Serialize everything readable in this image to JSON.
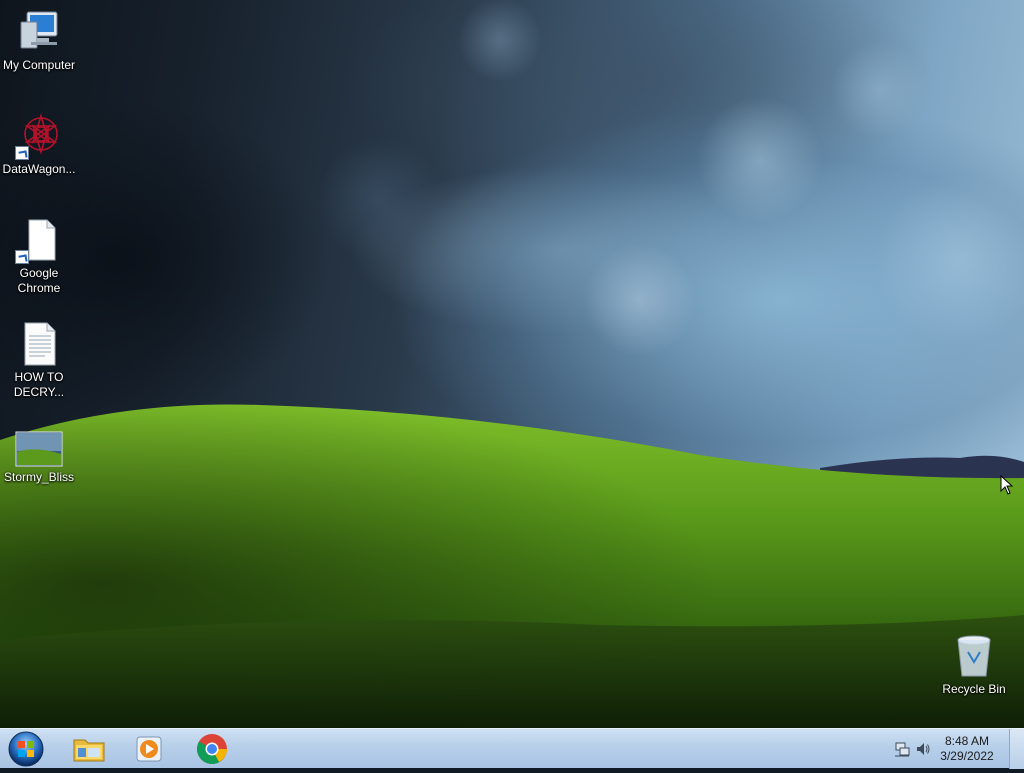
{
  "desktop": {
    "icons": [
      {
        "label": "My Computer",
        "icon": "computer-icon"
      },
      {
        "label": "DataWagon...",
        "icon": "datawagon-shortcut-icon"
      },
      {
        "label": "Google Chrome",
        "icon": "chrome-shortcut-icon"
      },
      {
        "label": "HOW TO DECRY...",
        "icon": "text-document-icon"
      },
      {
        "label": "Stormy_Bliss",
        "icon": "image-file-icon"
      },
      {
        "label": "Recycle Bin",
        "icon": "recycle-bin-icon"
      }
    ]
  },
  "taskbar": {
    "start": {
      "icon": "windows-start-orb-icon"
    },
    "pinned": [
      {
        "name": "Windows Explorer",
        "icon": "folder-icon"
      },
      {
        "name": "Windows Media Player",
        "icon": "media-player-icon"
      },
      {
        "name": "Google Chrome",
        "icon": "chrome-icon"
      }
    ],
    "tray": {
      "network_icon": "network-icon",
      "volume_icon": "speaker-icon",
      "time": "8:48 AM",
      "date": "3/29/2022"
    }
  },
  "colors": {
    "taskbar": "#b7cfe9",
    "grass": "#4e8a16",
    "sky_light": "#9fc1da",
    "sky_dark": "#17212c"
  }
}
